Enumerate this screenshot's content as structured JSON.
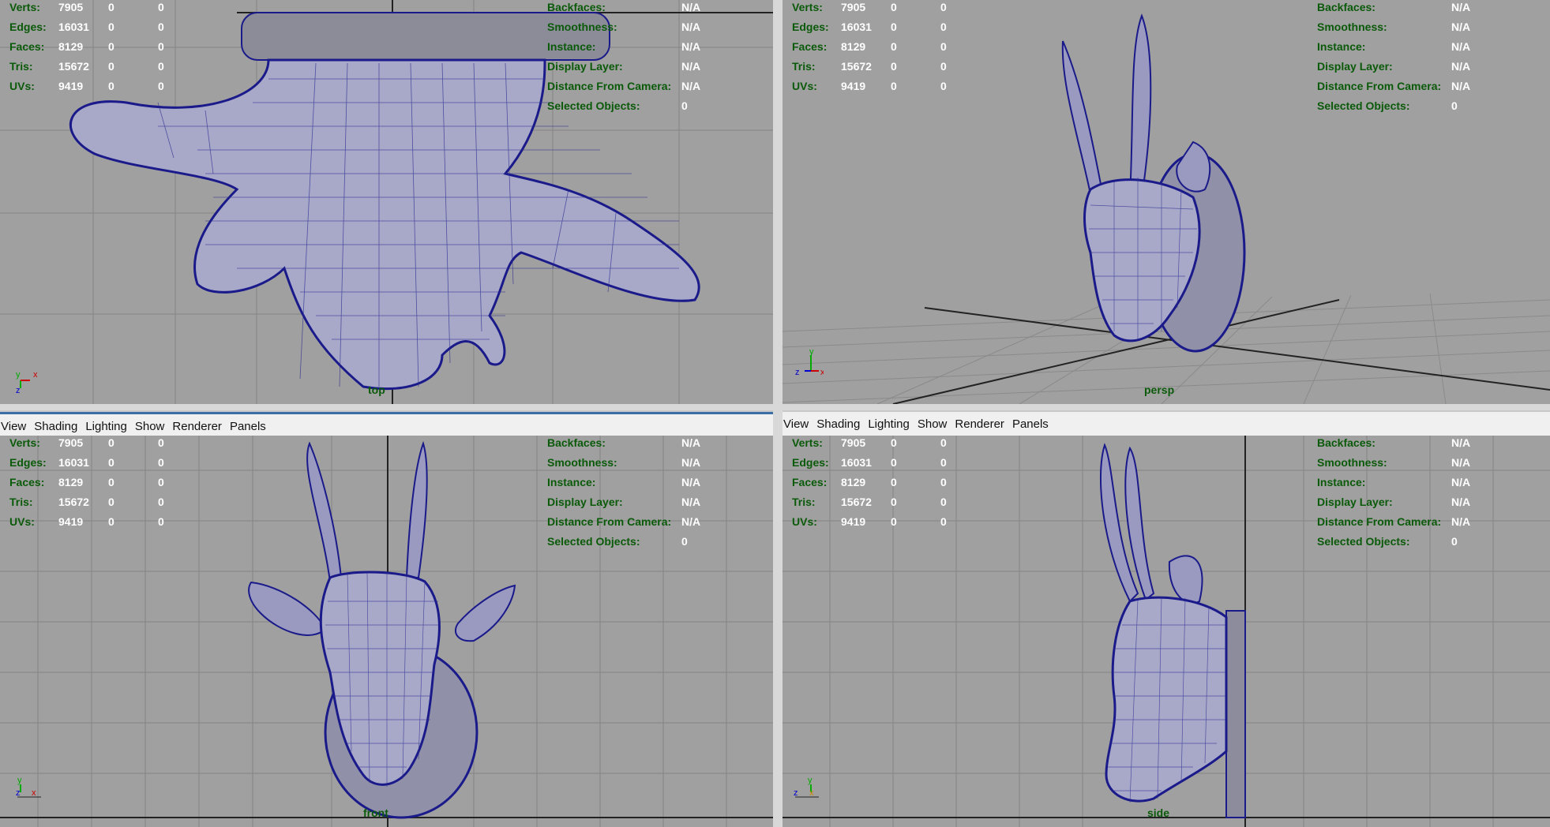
{
  "menu": {
    "items": [
      "View",
      "Shading",
      "Lighting",
      "Show",
      "Renderer",
      "Panels"
    ]
  },
  "stats": {
    "rows": [
      {
        "label": "Verts:",
        "v1": "7905",
        "v2": "0",
        "v3": "0"
      },
      {
        "label": "Edges:",
        "v1": "16031",
        "v2": "0",
        "v3": "0"
      },
      {
        "label": "Faces:",
        "v1": "8129",
        "v2": "0",
        "v3": "0"
      },
      {
        "label": "Tris:",
        "v1": "15672",
        "v2": "0",
        "v3": "0"
      },
      {
        "label": "UVs:",
        "v1": "9419",
        "v2": "0",
        "v3": "0"
      }
    ]
  },
  "info": {
    "rows": [
      {
        "label": "Backfaces:",
        "value": "N/A"
      },
      {
        "label": "Smoothness:",
        "value": "N/A"
      },
      {
        "label": "Instance:",
        "value": "N/A"
      },
      {
        "label": "Display Layer:",
        "value": "N/A"
      },
      {
        "label": "Distance From Camera:",
        "value": "N/A"
      },
      {
        "label": "Selected Objects:",
        "value": "0"
      }
    ]
  },
  "viewports": {
    "top": {
      "camera": "top",
      "axes": [
        "y",
        "x",
        "z"
      ]
    },
    "persp": {
      "camera": "persp",
      "axes": [
        "y",
        "z",
        "x"
      ]
    },
    "front": {
      "camera": "front",
      "axes": [
        "y",
        "z",
        "x"
      ]
    },
    "side": {
      "camera": "side",
      "axes": [
        "y",
        "z",
        "x"
      ]
    }
  },
  "colors": {
    "viewport_bg": "#a0a0a0",
    "hud_label": "#0a5a0a",
    "hud_value": "#ffffff",
    "wireframe": "#1a1a8a",
    "grid": "#7a7a7a"
  }
}
